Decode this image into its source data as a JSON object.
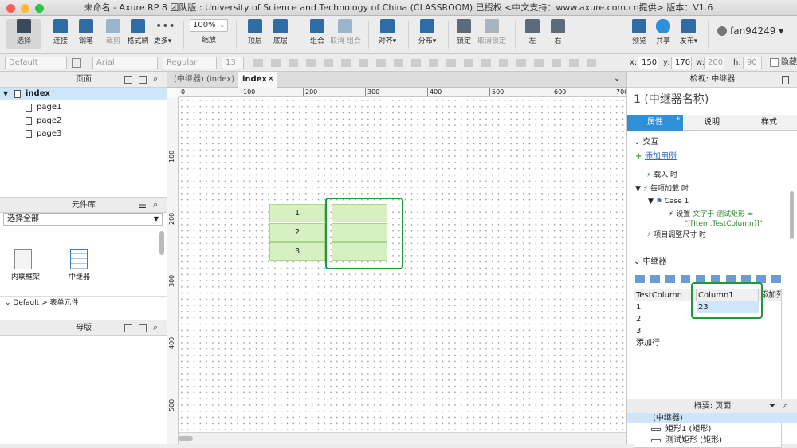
{
  "window": {
    "title": "未命名 - Axure RP 8 团队版 : University of Science and Technology of China (CLASSROOM) 已授权    <中文支持：www.axure.com.cn提供> 版本：V1.6"
  },
  "toolbar": {
    "select": "选择",
    "connect": "连接",
    "pen": "钢笔",
    "crop": "裁剪",
    "format_painter": "格式刷",
    "more": "更多▾",
    "zoom_value": "100%",
    "zoom_label": "缩放",
    "top": "顶层",
    "bottom": "底层",
    "group": "组合",
    "ungroup": "取消 组合",
    "align": "对齐▾",
    "distribute": "分布▾",
    "lock": "锁定",
    "unlock": "取消锁定",
    "left": "左",
    "right": "右",
    "preview": "预览",
    "share": "共享",
    "publish": "发布▾",
    "user": "fan94249 ▾"
  },
  "format": {
    "style": "Default",
    "font": "Arial",
    "weight": "Regular",
    "size": "13",
    "x_label": "x:",
    "x": "150",
    "y_label": "y:",
    "y": "170",
    "w_label": "w:",
    "w": "200",
    "h_label": "h:",
    "h": "90",
    "hide_label": "隐藏"
  },
  "pages_panel": {
    "title": "页面",
    "root": "index",
    "pages": [
      "page1",
      "page2",
      "page3"
    ]
  },
  "library_panel": {
    "title": "元件库",
    "select": "选择全部",
    "items": [
      "内联框架",
      "中继器"
    ],
    "section": "Default > 表单元件"
  },
  "masters_panel": {
    "title": "母版"
  },
  "canvas": {
    "tabs": [
      "(中继器) (index)",
      "index"
    ],
    "hruler": [
      "0",
      "100",
      "200",
      "300",
      "400",
      "500",
      "600",
      "700"
    ],
    "vruler": [
      "100",
      "200",
      "300",
      "400",
      "500"
    ],
    "rows": [
      "1",
      "2",
      "3"
    ]
  },
  "inspector": {
    "header": "检视: 中继器",
    "name": "1  (中继器名称)",
    "tabs": [
      "属性",
      "说明",
      "样式"
    ],
    "interactions_title": "交互",
    "add_case": "添加用例",
    "events": [
      "载入 时",
      "每项加载 时",
      "Case 1",
      "设置",
      "文字于 测试矩形 =",
      "\"[[Item.TestColumn]]\"",
      "项目调整尺寸 时"
    ],
    "repeater_title": "中继器",
    "dataset_headers": [
      "TestColumn",
      "Column1",
      "添加列"
    ],
    "dataset_rows": [
      [
        "1",
        "23"
      ],
      [
        "2",
        ""
      ],
      [
        "3",
        ""
      ]
    ],
    "add_row": "添加行",
    "outline_title": "概要: 页面",
    "outline_items": [
      "(中继器)",
      "矩形1 (矩形)",
      "测试矩形 (矩形)"
    ]
  },
  "colors": {
    "accent_blue": "#2f8fd8",
    "highlight_green": "#1e9a3a",
    "rep_green": "#d6f0c2",
    "selection": "#cfe6fa"
  }
}
